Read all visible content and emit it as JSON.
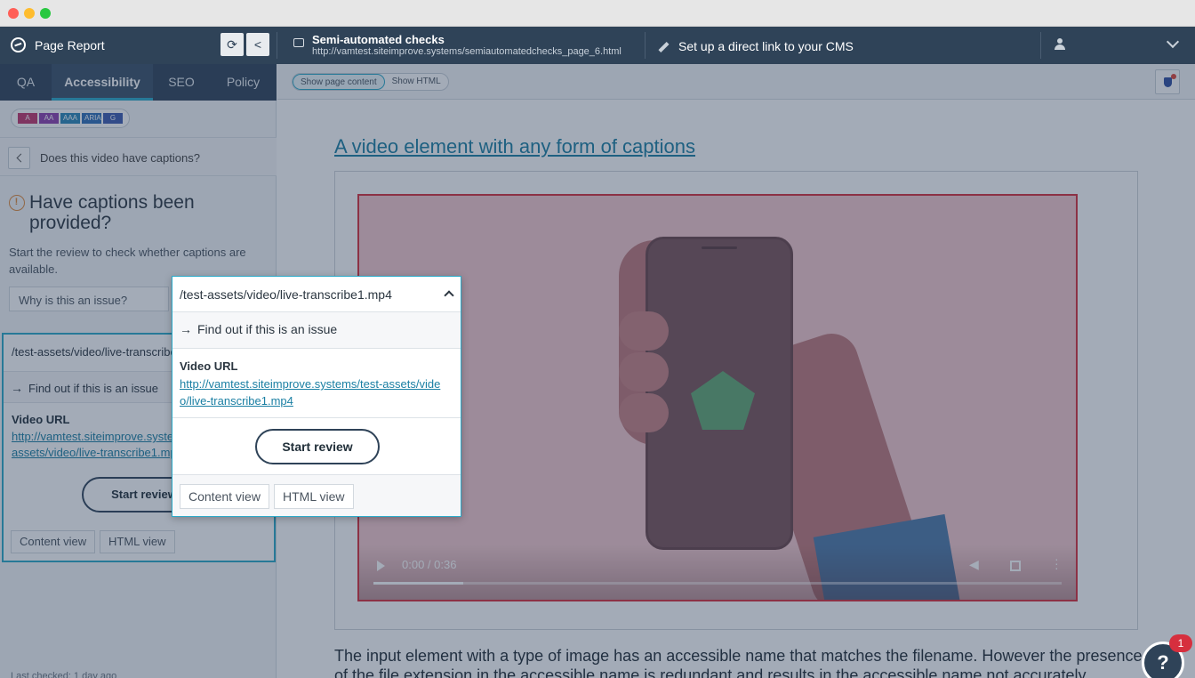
{
  "window": {
    "title": "Page Report"
  },
  "topbar": {
    "checks_title": "Semi-automated checks",
    "checks_url": "http://vamtest.siteimprove.systems/semiautomatedchecks_page_6.html",
    "cms_link": "Set up a direct link to your CMS"
  },
  "tabs": [
    {
      "label": "QA"
    },
    {
      "label": "Accessibility"
    },
    {
      "label": "SEO"
    },
    {
      "label": "Policy"
    }
  ],
  "conformance_levels": [
    {
      "label": "A",
      "color": "#c2356b"
    },
    {
      "label": "AA",
      "color": "#8e3fae"
    },
    {
      "label": "AAA",
      "color": "#2a87b8"
    },
    {
      "label": "ARIA",
      "color": "#2f6fb8"
    },
    {
      "label": "G",
      "color": "#3c5bb0"
    }
  ],
  "sidebar": {
    "question": "Does this video have captions?",
    "issue_title": "Have captions been provided?",
    "issue_description": "Start the review to check whether captions are available.",
    "why_button": "Why is this an issue?",
    "card": {
      "path": "/test-assets/video/live-transcribe1.mp4",
      "find_out": "Find out if this is an issue",
      "video_url_label": "Video URL",
      "video_url": "http://vamtest.siteimprove.systems/test-assets/video/live-transcribe1.mp4",
      "start_review": "Start review",
      "content_view": "Content view",
      "html_view": "HTML view"
    },
    "last_check": "Last checked: 1 day ago"
  },
  "content_toolbar": {
    "show_page_content": "Show page content",
    "show_html": "Show HTML"
  },
  "content": {
    "heading": "A video element with any form of captions",
    "video_time": "0:00 / 0:36",
    "video_progress": 0.13,
    "paragraph": "The input element with a type of image has an accessible name that matches the filename. However the presence of the file extension in the accessible name is redundant and results in the accessible name not accurately"
  },
  "popup": {
    "path": "/test-assets/video/live-transcribe1.mp4",
    "find_out": "Find out if this is an issue",
    "video_url_label": "Video URL",
    "video_url": "http://vamtest.siteimprove.systems/test-assets/video/live-transcribe1.mp4",
    "start_review": "Start review",
    "content_view": "Content view",
    "html_view": "HTML view"
  },
  "help": {
    "label": "?",
    "count": "1"
  }
}
